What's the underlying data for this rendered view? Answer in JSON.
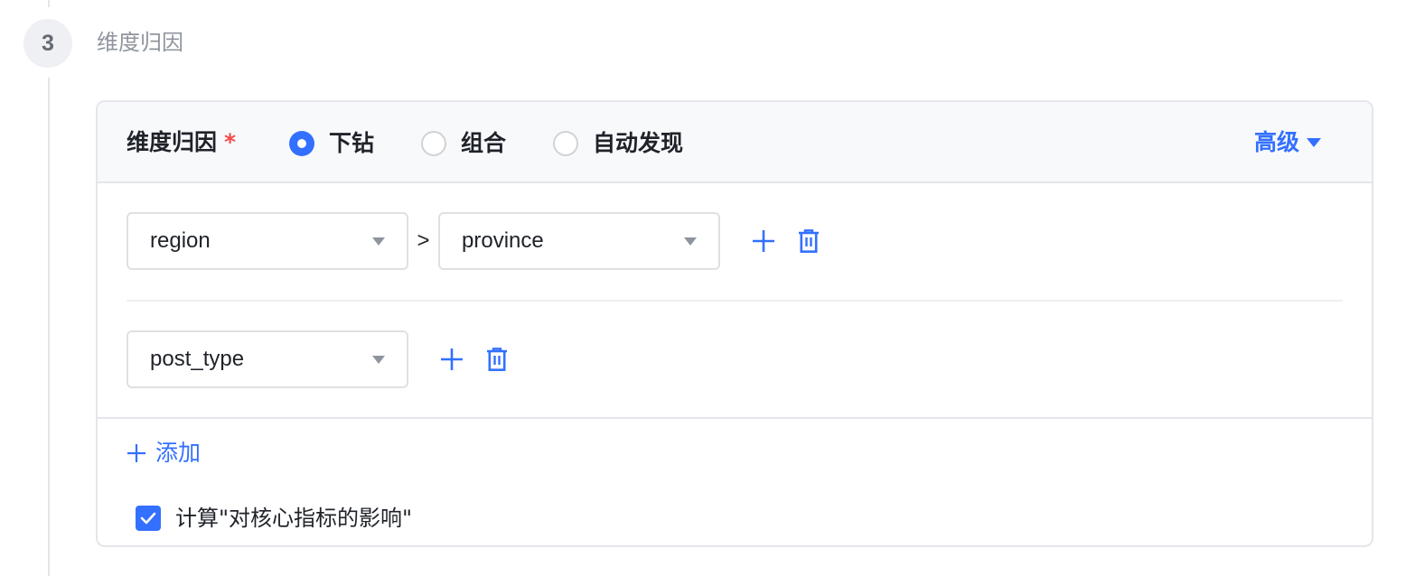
{
  "step": {
    "number": "3",
    "title": "维度归因"
  },
  "card": {
    "field_label": "维度归因",
    "required_mark": "*",
    "mode_options": [
      {
        "label": "下钻",
        "checked": true
      },
      {
        "label": "组合",
        "checked": false
      },
      {
        "label": "自动发现",
        "checked": false
      }
    ],
    "advanced_label": "高级"
  },
  "rows": [
    {
      "selects": [
        "region",
        "province"
      ],
      "separator": ">"
    },
    {
      "selects": [
        "post_type"
      ]
    }
  ],
  "add_label": "添加",
  "impact_checkbox": {
    "label": "计算\"对核心指标的影响\"",
    "checked": true
  },
  "colors": {
    "accent": "#3370ff",
    "required": "#f54a45",
    "muted_text": "#8f959e",
    "border": "#dee0e3"
  },
  "icons": [
    "plus-icon",
    "trash-icon",
    "caret-down-icon",
    "check-icon"
  ]
}
